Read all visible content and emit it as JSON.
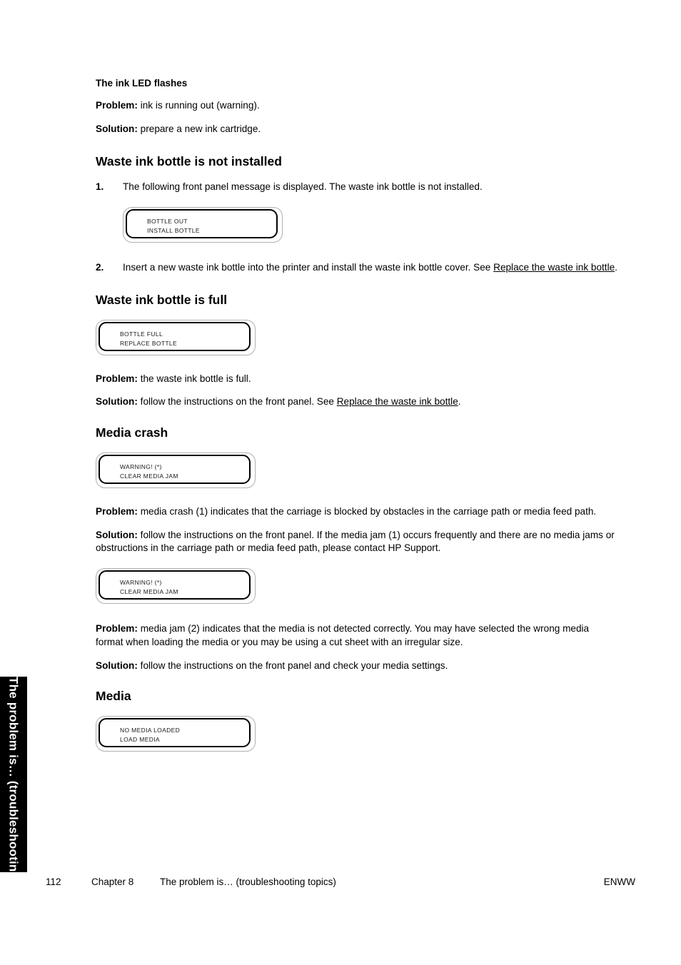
{
  "side_tab": {
    "label": "The problem is… (troubleshooting topics)"
  },
  "body": {
    "ink_led": {
      "heading": "The ink LED flashes",
      "problem_label": "Problem:",
      "problem_text": " ink is running out (warning).",
      "solution_label": "Solution:",
      "solution_text": " prepare a new ink cartridge."
    },
    "bottle_not_installed": {
      "heading": "Waste ink bottle is not installed",
      "step1_num": "1.",
      "step1_text": "The following front panel message is displayed. The waste ink bottle is not installed.",
      "panel": {
        "line1": "BOTTLE OUT",
        "line2": "INSTALL BOTTLE"
      },
      "step2_num": "2.",
      "step2_text_before": "Insert a new waste ink bottle into the printer and install the waste ink bottle cover. See ",
      "step2_link": "Replace the waste ink bottle",
      "step2_text_after": "."
    },
    "bottle_full": {
      "heading": "Waste ink bottle is full",
      "panel": {
        "line1": "BOTTLE FULL",
        "line2": "REPLACE BOTTLE"
      },
      "problem_label": "Problem:",
      "problem_text": " the waste ink bottle is full.",
      "solution_label": "Solution:",
      "solution_text_before": " follow the instructions on the front panel. See ",
      "solution_link": "Replace the waste ink bottle",
      "solution_text_after": "."
    },
    "media_crash": {
      "heading": "Media crash",
      "panel1": {
        "line1": "WARNING! (*)",
        "line2": "CLEAR MEDIA JAM"
      },
      "problem1_label": "Problem:",
      "problem1_text": " media crash (1) indicates that the carriage is blocked by obstacles in the carriage path or media feed path.",
      "solution1_label": "Solution:",
      "solution1_text": " follow the instructions on the front panel. If the media jam (1) occurs frequently and there are no media jams or obstructions in the carriage path or media feed path, please contact HP Support.",
      "panel2": {
        "line1": "WARNING! (*)",
        "line2": "CLEAR MEDIA JAM"
      },
      "problem2_label": "Problem:",
      "problem2_text": " media jam (2) indicates that the media is not detected correctly. You may have selected the wrong media format when loading the media or you may be using a cut sheet with an irregular size.",
      "solution2_label": "Solution:",
      "solution2_text": " follow the instructions on the front panel and check your media settings."
    },
    "media": {
      "heading": "Media",
      "panel": {
        "line1": "NO MEDIA LOADED",
        "line2": "LOAD MEDIA"
      }
    }
  },
  "footer": {
    "page_number": "112",
    "chapter": "Chapter 8",
    "chapter_title": "The problem is… (troubleshooting topics)",
    "locale": "ENWW"
  },
  "colors": {
    "text": "#000000",
    "tab_background": "#000000",
    "tab_text": "#ffffff",
    "panel_outer_border": "#b0b0b0",
    "panel_inner_border": "#000000"
  }
}
